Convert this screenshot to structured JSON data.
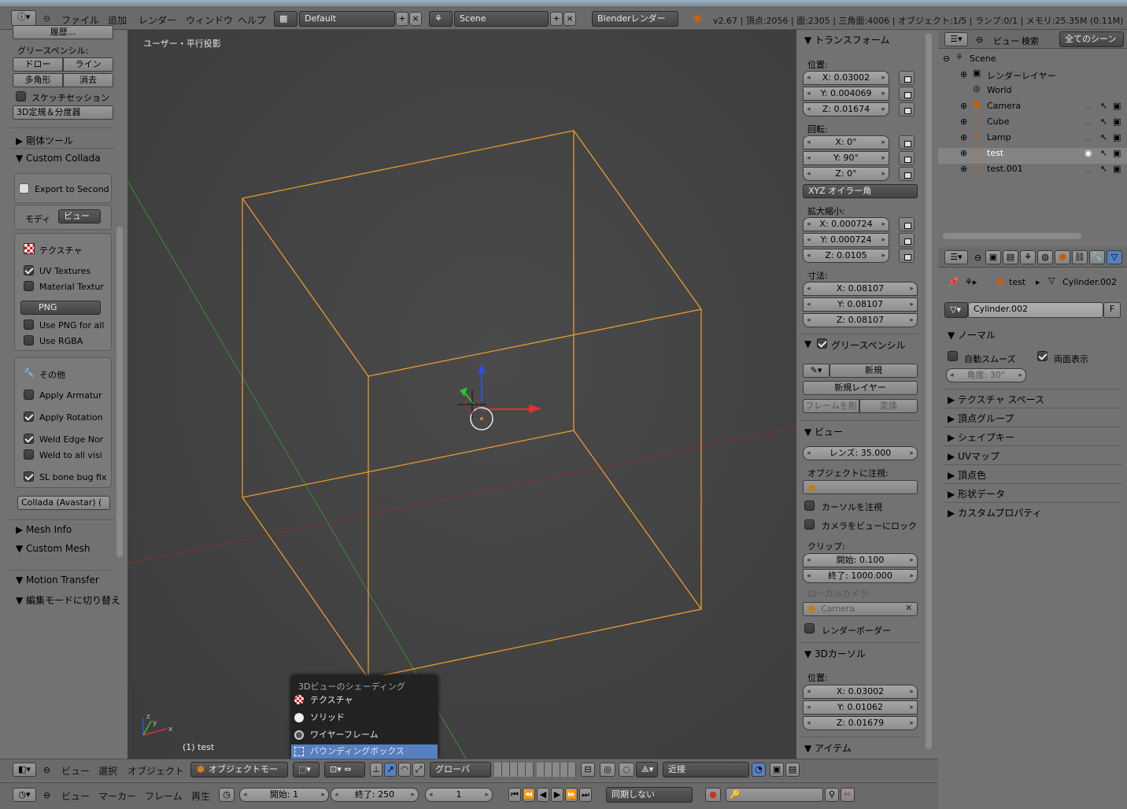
{
  "header": {
    "menus": [
      "ファイル",
      "追加",
      "レンダー",
      "ウィンドウ",
      "ヘルプ"
    ],
    "layout": "Default",
    "scene": "Scene",
    "engine": "Blenderレンダー",
    "stats": "v2.67 | 頂点:2056 | 面:2305 | 三角面:4006 | オブジェクト:1/5 | ランプ:0/1 | メモリ:25.35M (0.11M) | tes"
  },
  "tool": {
    "top_cut": "履歴...",
    "grease_title": "グリースペンシル:",
    "draw": "ドロー",
    "line": "ライン",
    "poly": "多角形",
    "erase": "消去",
    "sketch": "スケッチセッション",
    "ruler": "3D定規＆分度器",
    "rigid": "剛体ツール",
    "collada": "Custom Collada",
    "export": "Export to Second",
    "mode_label": "モディ",
    "mode_value": "ビュー",
    "tex_head": "テクスチャ",
    "uv": "UV Textures",
    "mat": "Material Textur",
    "png": "PNG",
    "use_png": "Use PNG for all",
    "rgba": "Use RGBA",
    "other": "その他",
    "armature": "Apply Armatur",
    "rotation": "Apply Rotation",
    "weld": "Weld Edge Nor",
    "weld_all": "Weld to all visi",
    "slbone": "SL bone bug fix",
    "collada_av": "Collada (Avastar) (",
    "meshinfo": "Mesh Info",
    "custommesh": "Custom Mesh",
    "motion": "Motion Transfer",
    "editmode": "編集モードに切り替え"
  },
  "viewport": {
    "title": "ユーザー・平行投影",
    "object": "(1) test",
    "axis_x": "x",
    "axis_y": "y",
    "axis_z": "z"
  },
  "shading": {
    "title": "3Dビューのシェーディング",
    "items": [
      "テクスチャ",
      "ソリッド",
      "ワイヤーフレーム",
      "バウンディングボックス"
    ]
  },
  "npanel": {
    "transform": "トランスフォーム",
    "loc": "位置:",
    "loc_x": "X: 0.03002",
    "loc_y": "Y: 0.004069",
    "loc_z": "Z: 0.01674",
    "rot": "回転:",
    "rot_x": "X: 0°",
    "rot_y": "Y: 90°",
    "rot_z": "Z: 0°",
    "euler": "XYZ オイラー角",
    "scale": "拡大縮小:",
    "sc_x": "X: 0.000724",
    "sc_y": "Y: 0.000724",
    "sc_z": "Z: 0.0105",
    "dim": "寸法:",
    "d_x": "X: 0.08107",
    "d_y": "Y: 0.08107",
    "d_z": "Z: 0.08107",
    "grease": "グリースペンシル",
    "new": "新規",
    "newlayer": "新規レイヤー",
    "delframe": "フレームを削",
    "convert": "変換",
    "view": "ビュー",
    "lens": "レンズ: 35.000",
    "lockobj": "オブジェクトに注視:",
    "lockcursor": "カーソルを注視",
    "lockcam": "カメラをビューにロック",
    "clip": "クリップ:",
    "clip_start": "開始: 0.100",
    "clip_end": "終了: 1000.000",
    "localcam": "ローカルカメラ:",
    "camera": "Camera",
    "border": "レンダーボーダー",
    "cursor": "3Dカーソル",
    "cur_loc": "位置:",
    "cur_x": "X: 0.03002",
    "cur_y": "Y: 0.01062",
    "cur_z": "Z: 0.01679",
    "item": "アイテム"
  },
  "outliner": {
    "view": "ビュー",
    "search": "検索",
    "filter": "全てのシーン",
    "scene": "Scene",
    "renderlayer": "レンダーレイヤー",
    "world": "World",
    "camera": "Camera",
    "cube": "Cube",
    "lamp": "Lamp",
    "test": "test",
    "test001": "test.001"
  },
  "properties": {
    "obj": "test",
    "mesh": "Cylinder.002",
    "meshname": "Cylinder.002",
    "fake": "F",
    "normal": "ノーマル",
    "autosmooth": "自動スムーズ",
    "doublesided": "両面表示",
    "angle": "角度: 30°",
    "sections": [
      "テクスチャ スペース",
      "頂点グループ",
      "シェイプキー",
      "UVマップ",
      "頂点色",
      "形状データ",
      "カスタムプロパティ"
    ]
  },
  "bottom": {
    "view": "ビュー",
    "select": "選択",
    "object": "オブジェクト",
    "mode": "オブジェクトモー",
    "global": "グローバ",
    "snap": "近接",
    "view2": "ビュー",
    "marker": "マーカー",
    "frame": "フレーム",
    "play": "再生",
    "start": "開始: 1",
    "end": "終了: 250",
    "current": "1",
    "sync": "同期しない"
  }
}
